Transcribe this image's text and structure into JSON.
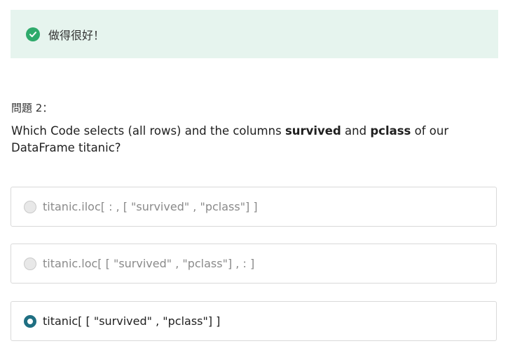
{
  "colors": {
    "success": "#2eaa6b",
    "success_bg": "#e6f4ee",
    "accent": "#1f6f82"
  },
  "feedback": {
    "icon": "check-circle-icon",
    "text": "做得很好！"
  },
  "question": {
    "label": "問題 2：",
    "parts": {
      "p1": "Which Code selects (all rows) and the columns ",
      "b1": "survived",
      "p2": " and ",
      "b2": "pclass",
      "p3": " of our DataFrame titanic?"
    }
  },
  "options": [
    {
      "text": "titanic.iloc[ : , [ \"survived\" , \"pclass\"] ]",
      "selected": false
    },
    {
      "text": "titanic.loc[ [ \"survived\" , \"pclass\"] , : ]",
      "selected": false
    },
    {
      "text": "titanic[ [ \"survived\" , \"pclass\"] ]",
      "selected": true
    }
  ]
}
